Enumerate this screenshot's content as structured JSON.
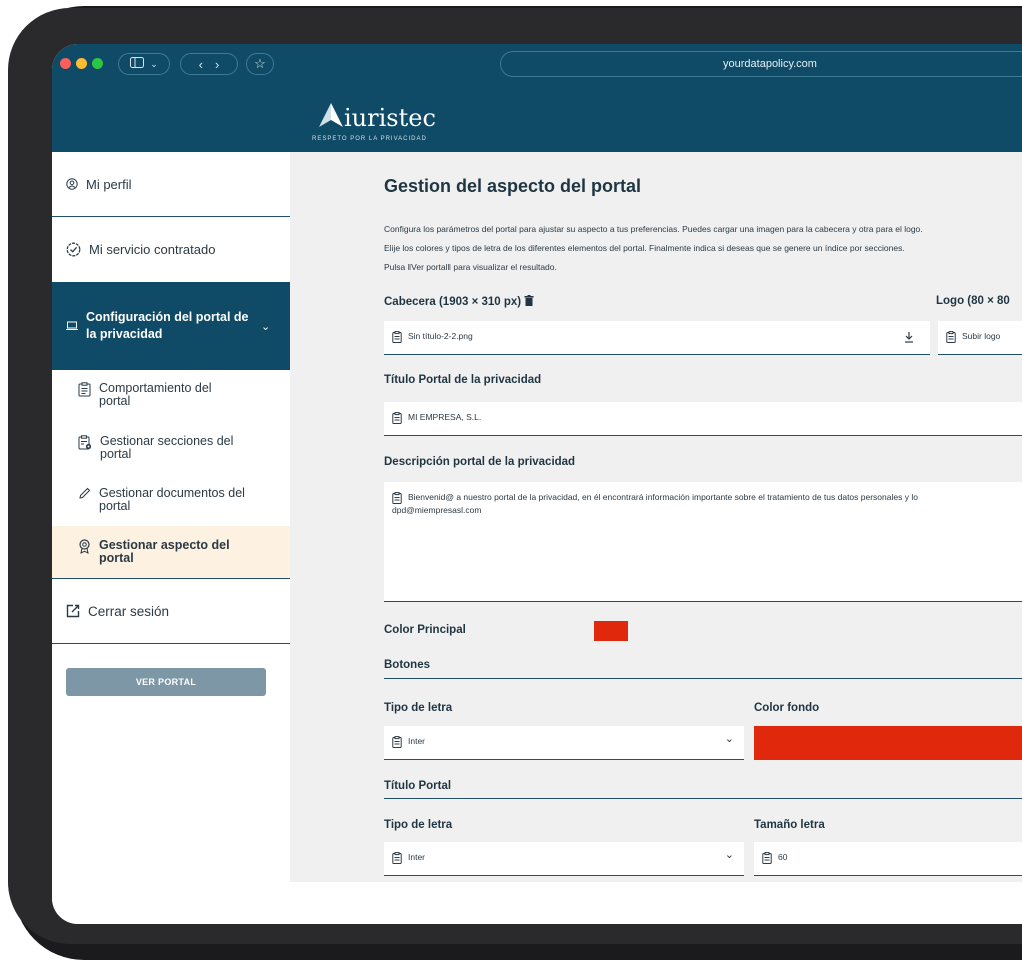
{
  "browser": {
    "url": "yourdatapolicy.com"
  },
  "brand": {
    "name": "iuristec",
    "tagline": "RESPETO POR LA PRIVACIDAD"
  },
  "sidebar": {
    "items": [
      {
        "label": "Mi perfil",
        "icon": "user-circle-icon"
      },
      {
        "label": "Mi servicio contratado",
        "icon": "check-badge-icon"
      },
      {
        "label": "Configuración del portal de la privacidad",
        "icon": "laptop-icon"
      }
    ],
    "subitems": [
      {
        "label1": "Comportamiento del",
        "label2": "portal",
        "icon": "document-icon"
      },
      {
        "label1": "Gestionar secciones del",
        "label2": "portal",
        "icon": "document-gear-icon"
      },
      {
        "label1": "Gestionar documentos del",
        "label2": "portal",
        "icon": "pen-icon"
      },
      {
        "label1": "Gestionar aspecto del",
        "label2": "portal",
        "icon": "badge-icon"
      }
    ],
    "logout": "Cerrar sesión",
    "ver_portal": "VER PORTAL"
  },
  "main": {
    "title": "Gestion del aspecto del portal",
    "desc1": "Configura los parámetros del portal para ajustar su aspecto a tus preferencias. Puedes cargar una imagen para la cabecera y otra para el logo.",
    "desc2": "Elije los colores y tipos de letra de los diferentes elementos del portal. Finalmente indica si deseas que se genere un índice por secciones.",
    "desc3": "Pulsa ‖Ver portal‖ para visualizar el resultado.",
    "cabecera_label": "Cabecera (1903 × 310 px)",
    "cabecera_value": "Sin título-2-2.png",
    "logo_label": "Logo (80 × 80",
    "logo_value": "Subir logo",
    "titulo_label": "Título Portal de la privacidad",
    "titulo_value": "MI EMPRESA, S.L.",
    "descripcion_label": "Descripción portal de la privacidad",
    "descripcion_line1": "Bienvenid@ a nuestro portal de la privacidad, en él encontrará información importante sobre el tratamiento de tus datos personales y lo",
    "descripcion_line2": "dpd@miempresasl.com",
    "color_principal_label": "Color Principal",
    "color_principal": "#e0280c",
    "botones_label": "Botones",
    "tipo_letra_label": "Tipo de letra",
    "botones_font": "Inter",
    "color_fondo_label": "Color fondo",
    "color_fondo": "#e0280c",
    "titulo_portal_label": "Título Portal",
    "tipo_letra_label2": "Tipo de letra",
    "titulo_font": "Inter",
    "tamano_label": "Tamaño letra",
    "tamano_value": "60"
  }
}
